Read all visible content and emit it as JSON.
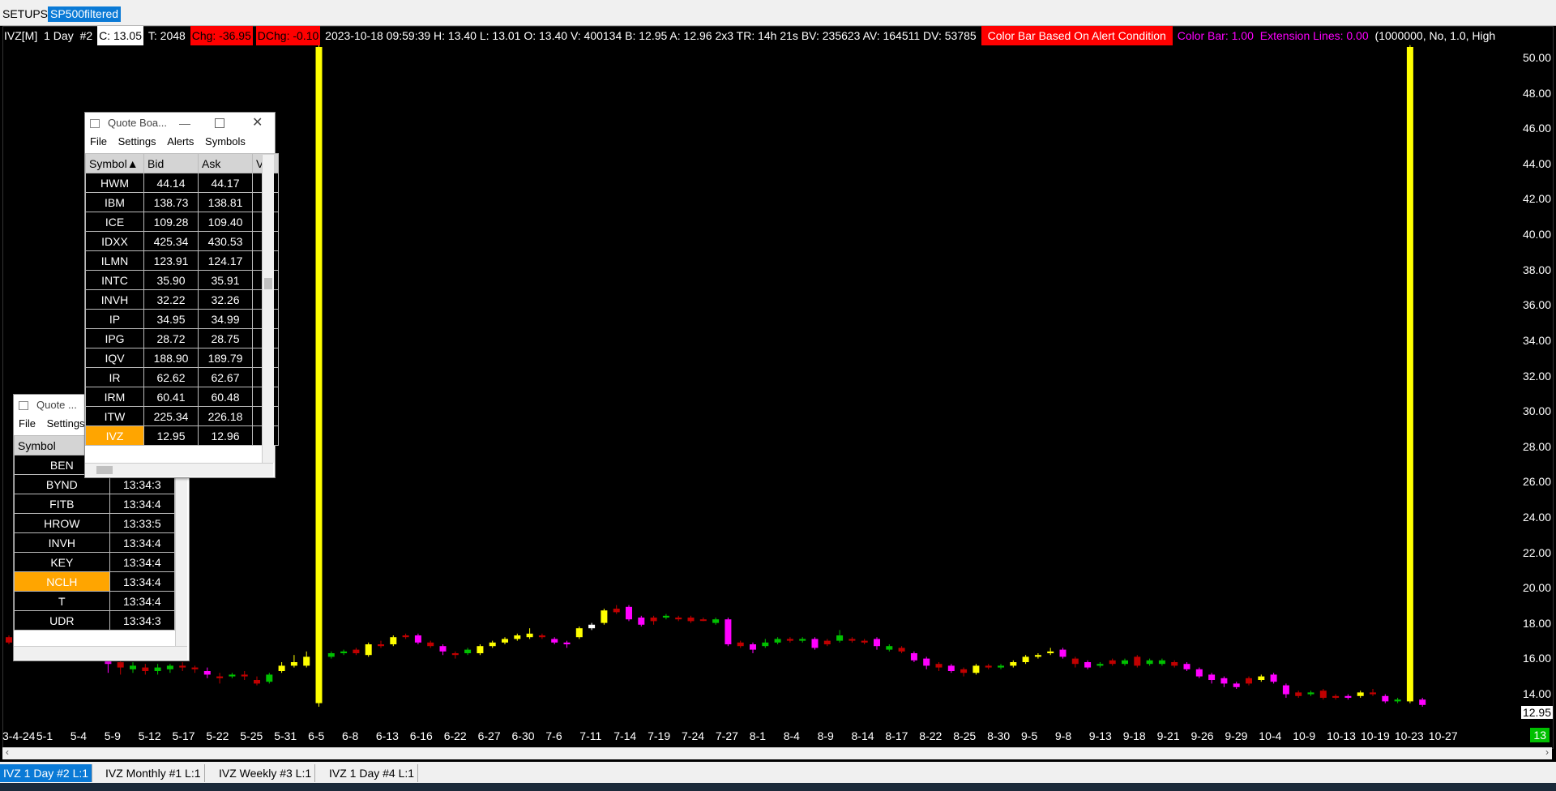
{
  "top_tabs": [
    "SETUPS",
    "SP500filtered"
  ],
  "infobar": {
    "symbol": "IVZ[M]",
    "interval": "1 Day",
    "chart_no": "#2",
    "close": "C: 13.05",
    "ticks": "T: 2048",
    "chg": "Chg: -36.95",
    "dchg": "DChg: -0.10",
    "details": "2023-10-18 09:59:39 H: 13.40 L: 13.01 O: 13.40 V: 400134 B: 12.95 A: 12.96 2x3 TR: 14h 21s BV: 235623 AV: 164511 DV: 53785",
    "alert": "Color Bar Based On Alert Condition",
    "color_bar": "Color Bar: 1.00",
    "extension": "Extension Lines: 0.00",
    "params": "(1000000, No, 1.0, High"
  },
  "price_box": "12.95",
  "y_ticks": [
    "50.00",
    "48.00",
    "46.00",
    "44.00",
    "42.00",
    "40.00",
    "38.00",
    "36.00",
    "34.00",
    "32.00",
    "30.00",
    "28.00",
    "26.00",
    "24.00",
    "22.00",
    "20.00",
    "18.00",
    "16.00",
    "14.00"
  ],
  "x_ticks": [
    "3-4-24",
    "5-1",
    "5-4",
    "5-9",
    "5-12",
    "5-17",
    "5-22",
    "5-25",
    "5-31",
    "6-5",
    "6-8",
    "6-13",
    "6-16",
    "6-22",
    "6-27",
    "6-30",
    "7-6",
    "7-11",
    "7-14",
    "7-19",
    "7-24",
    "7-27",
    "8-1",
    "8-4",
    "8-9",
    "8-14",
    "8-17",
    "8-22",
    "8-25",
    "8-30",
    "9-5",
    "9-8",
    "9-13",
    "9-18",
    "9-21",
    "9-26",
    "9-29",
    "10-4",
    "10-9",
    "10-13",
    "10-19",
    "10-23",
    "10-27"
  ],
  "x_last": "13",
  "quote_board": {
    "title": "Quote Boa...",
    "menu": [
      "File",
      "Settings",
      "Alerts",
      "Symbols"
    ],
    "headers": [
      "Symbol",
      "Bid",
      "Ask",
      "Vo"
    ],
    "rows": [
      {
        "symbol": "HWM",
        "bid": "44.14",
        "ask": "44.17"
      },
      {
        "symbol": "IBM",
        "bid": "138.73",
        "ask": "138.81"
      },
      {
        "symbol": "ICE",
        "bid": "109.28",
        "ask": "109.40"
      },
      {
        "symbol": "IDXX",
        "bid": "425.34",
        "ask": "430.53"
      },
      {
        "symbol": "ILMN",
        "bid": "123.91",
        "ask": "124.17"
      },
      {
        "symbol": "INTC",
        "bid": "35.90",
        "ask": "35.91"
      },
      {
        "symbol": "INVH",
        "bid": "32.22",
        "ask": "32.26"
      },
      {
        "symbol": "IP",
        "bid": "34.95",
        "ask": "34.99"
      },
      {
        "symbol": "IPG",
        "bid": "28.72",
        "ask": "28.75"
      },
      {
        "symbol": "IQV",
        "bid": "188.90",
        "ask": "189.79"
      },
      {
        "symbol": "IR",
        "bid": "62.62",
        "ask": "62.67"
      },
      {
        "symbol": "IRM",
        "bid": "60.41",
        "ask": "60.48"
      },
      {
        "symbol": "ITW",
        "bid": "225.34",
        "ask": "226.18"
      },
      {
        "symbol": "IVZ",
        "bid": "12.95",
        "ask": "12.96"
      }
    ]
  },
  "quote_small": {
    "title": "Quote ...",
    "menu": [
      "File",
      "Settings"
    ],
    "header": "Symbol",
    "rows": [
      {
        "symbol": "BEN",
        "time": ""
      },
      {
        "symbol": "BYND",
        "time": "13:34:3"
      },
      {
        "symbol": "FITB",
        "time": "13:34:4"
      },
      {
        "symbol": "HROW",
        "time": "13:33:5"
      },
      {
        "symbol": "INVH",
        "time": "13:34:4"
      },
      {
        "symbol": "KEY",
        "time": "13:34:4"
      },
      {
        "symbol": "NCLH",
        "time": "13:34:4"
      },
      {
        "symbol": "T",
        "time": "13:34:4"
      },
      {
        "symbol": "UDR",
        "time": "13:34:3"
      }
    ]
  },
  "bottom_tabs": [
    "IVZ  1 Day   #2 L:1",
    "IVZ  Monthly  #1 L:1",
    "IVZ  Weekly  #3 L:1",
    "IVZ  1 Day   #4 L:1"
  ],
  "chart_data": {
    "type": "candlestick",
    "ylim": [
      13.0,
      50.5
    ],
    "candles": [
      {
        "i": 0,
        "o": 16.9,
        "c": 16.6,
        "h": 17.0,
        "l": 16.5,
        "col": "#c00000"
      },
      {
        "i": 8,
        "o": 15.4,
        "c": 15.9,
        "h": 16.2,
        "l": 14.9,
        "col": "#ff00ff"
      },
      {
        "i": 9,
        "o": 15.5,
        "c": 15.2,
        "h": 15.8,
        "l": 14.8,
        "col": "#c00000"
      },
      {
        "i": 10,
        "o": 15.1,
        "c": 15.3,
        "h": 15.5,
        "l": 14.9,
        "col": "#00c000"
      },
      {
        "i": 11,
        "o": 15.2,
        "c": 15.0,
        "h": 15.4,
        "l": 14.8,
        "col": "#c00000"
      },
      {
        "i": 12,
        "o": 15.0,
        "c": 15.2,
        "h": 15.4,
        "l": 14.8,
        "col": "#00c000"
      },
      {
        "i": 13,
        "o": 15.1,
        "c": 15.3,
        "h": 15.4,
        "l": 14.9,
        "col": "#00c000"
      },
      {
        "i": 14,
        "o": 15.3,
        "c": 15.2,
        "h": 15.5,
        "l": 15.0,
        "col": "#c00000"
      },
      {
        "i": 15,
        "o": 15.2,
        "c": 15.1,
        "h": 15.3,
        "l": 14.9,
        "col": "#c00000"
      },
      {
        "i": 16,
        "o": 15.0,
        "c": 14.8,
        "h": 15.2,
        "l": 14.6,
        "col": "#ff00ff"
      },
      {
        "i": 17,
        "o": 14.7,
        "c": 14.6,
        "h": 14.9,
        "l": 14.3,
        "col": "#c00000"
      },
      {
        "i": 18,
        "o": 14.7,
        "c": 14.8,
        "h": 14.9,
        "l": 14.6,
        "col": "#00c000"
      },
      {
        "i": 19,
        "o": 14.8,
        "c": 14.7,
        "h": 15.0,
        "l": 14.5,
        "col": "#c00000"
      },
      {
        "i": 20,
        "o": 14.5,
        "c": 14.3,
        "h": 14.7,
        "l": 14.2,
        "col": "#c00000"
      },
      {
        "i": 21,
        "o": 14.4,
        "c": 14.8,
        "h": 14.9,
        "l": 14.3,
        "col": "#00c000"
      },
      {
        "i": 22,
        "o": 15.0,
        "c": 15.3,
        "h": 15.5,
        "l": 14.9,
        "col": "#ffff00"
      },
      {
        "i": 23,
        "o": 15.3,
        "c": 15.5,
        "h": 15.9,
        "l": 15.2,
        "col": "#ffff00"
      },
      {
        "i": 24,
        "o": 15.3,
        "c": 15.8,
        "h": 16.1,
        "l": 15.2,
        "col": "#ffff00"
      },
      {
        "i": 25,
        "o": 13.2,
        "c": 50.0,
        "h": 50.3,
        "l": 13.0,
        "col": "#ffff00"
      },
      {
        "i": 26,
        "o": 15.8,
        "c": 16.0,
        "h": 16.1,
        "l": 15.7,
        "col": "#00c000"
      },
      {
        "i": 27,
        "o": 16.0,
        "c": 16.1,
        "h": 16.2,
        "l": 15.9,
        "col": "#00c000"
      },
      {
        "i": 28,
        "o": 16.0,
        "c": 16.2,
        "h": 16.3,
        "l": 15.9,
        "col": "#c00000"
      },
      {
        "i": 29,
        "o": 15.9,
        "c": 16.5,
        "h": 16.6,
        "l": 15.8,
        "col": "#ffff00"
      },
      {
        "i": 30,
        "o": 16.5,
        "c": 16.4,
        "h": 16.7,
        "l": 16.3,
        "col": "#c00000"
      },
      {
        "i": 31,
        "o": 16.5,
        "c": 16.9,
        "h": 17.0,
        "l": 16.4,
        "col": "#ffff00"
      },
      {
        "i": 32,
        "o": 16.9,
        "c": 17.0,
        "h": 17.1,
        "l": 16.8,
        "col": "#c00000"
      },
      {
        "i": 33,
        "o": 17.0,
        "c": 16.6,
        "h": 17.1,
        "l": 16.5,
        "col": "#ff00ff"
      },
      {
        "i": 34,
        "o": 16.6,
        "c": 16.4,
        "h": 16.7,
        "l": 16.3,
        "col": "#c00000"
      },
      {
        "i": 35,
        "o": 16.4,
        "c": 16.1,
        "h": 16.5,
        "l": 15.9,
        "col": "#ff00ff"
      },
      {
        "i": 36,
        "o": 16.0,
        "c": 15.9,
        "h": 16.1,
        "l": 15.7,
        "col": "#c00000"
      },
      {
        "i": 37,
        "o": 16.0,
        "c": 16.2,
        "h": 16.3,
        "l": 15.9,
        "col": "#00c000"
      },
      {
        "i": 38,
        "o": 16.0,
        "c": 16.4,
        "h": 16.5,
        "l": 15.9,
        "col": "#ffff00"
      },
      {
        "i": 39,
        "o": 16.4,
        "c": 16.6,
        "h": 16.7,
        "l": 16.3,
        "col": "#ffff00"
      },
      {
        "i": 40,
        "o": 16.6,
        "c": 16.8,
        "h": 16.9,
        "l": 16.5,
        "col": "#ffff00"
      },
      {
        "i": 41,
        "o": 16.8,
        "c": 17.0,
        "h": 17.1,
        "l": 16.7,
        "col": "#ffff00"
      },
      {
        "i": 42,
        "o": 16.9,
        "c": 17.1,
        "h": 17.4,
        "l": 16.8,
        "col": "#ffff00"
      },
      {
        "i": 43,
        "o": 17.0,
        "c": 16.9,
        "h": 17.1,
        "l": 16.8,
        "col": "#c00000"
      },
      {
        "i": 44,
        "o": 16.8,
        "c": 16.6,
        "h": 16.9,
        "l": 16.5,
        "col": "#ff00ff"
      },
      {
        "i": 45,
        "o": 16.6,
        "c": 16.5,
        "h": 16.7,
        "l": 16.3,
        "col": "#ff00ff"
      },
      {
        "i": 46,
        "o": 16.9,
        "c": 17.4,
        "h": 17.5,
        "l": 16.8,
        "col": "#ffff00"
      },
      {
        "i": 47,
        "o": 17.4,
        "c": 17.6,
        "h": 17.7,
        "l": 17.3,
        "col": "#ffffff"
      },
      {
        "i": 48,
        "o": 17.7,
        "c": 18.4,
        "h": 18.5,
        "l": 17.6,
        "col": "#ffff00"
      },
      {
        "i": 49,
        "o": 18.5,
        "c": 18.3,
        "h": 18.7,
        "l": 18.2,
        "col": "#c00000"
      },
      {
        "i": 50,
        "o": 18.6,
        "c": 17.9,
        "h": 18.7,
        "l": 17.8,
        "col": "#ff00ff"
      },
      {
        "i": 51,
        "o": 18.0,
        "c": 17.6,
        "h": 18.1,
        "l": 17.5,
        "col": "#ff00ff"
      },
      {
        "i": 52,
        "o": 17.8,
        "c": 18.0,
        "h": 18.1,
        "l": 17.6,
        "col": "#c00000"
      },
      {
        "i": 53,
        "o": 18.0,
        "c": 18.1,
        "h": 18.2,
        "l": 17.9,
        "col": "#00c000"
      },
      {
        "i": 54,
        "o": 18.0,
        "c": 17.9,
        "h": 18.1,
        "l": 17.8,
        "col": "#c00000"
      },
      {
        "i": 55,
        "o": 18.0,
        "c": 17.8,
        "h": 18.1,
        "l": 17.7,
        "col": "#c00000"
      },
      {
        "i": 56,
        "o": 17.9,
        "c": 17.9,
        "h": 18.0,
        "l": 17.8,
        "col": "#c00000"
      },
      {
        "i": 57,
        "o": 17.7,
        "c": 17.9,
        "h": 18.0,
        "l": 17.6,
        "col": "#00c000"
      },
      {
        "i": 58,
        "o": 17.9,
        "c": 16.5,
        "h": 18.0,
        "l": 16.4,
        "col": "#ff00ff"
      },
      {
        "i": 59,
        "o": 16.6,
        "c": 16.4,
        "h": 16.7,
        "l": 16.3,
        "col": "#c00000"
      },
      {
        "i": 60,
        "o": 16.5,
        "c": 16.2,
        "h": 16.6,
        "l": 16.0,
        "col": "#ff00ff"
      },
      {
        "i": 61,
        "o": 16.4,
        "c": 16.6,
        "h": 16.8,
        "l": 16.3,
        "col": "#00c000"
      },
      {
        "i": 62,
        "o": 16.6,
        "c": 16.8,
        "h": 16.9,
        "l": 16.5,
        "col": "#00c000"
      },
      {
        "i": 63,
        "o": 16.8,
        "c": 16.7,
        "h": 16.9,
        "l": 16.6,
        "col": "#c00000"
      },
      {
        "i": 64,
        "o": 16.7,
        "c": 16.8,
        "h": 16.9,
        "l": 16.6,
        "col": "#00c000"
      },
      {
        "i": 65,
        "o": 16.8,
        "c": 16.3,
        "h": 16.9,
        "l": 16.2,
        "col": "#ff00ff"
      },
      {
        "i": 66,
        "o": 16.5,
        "c": 16.7,
        "h": 16.8,
        "l": 16.4,
        "col": "#c00000"
      },
      {
        "i": 67,
        "o": 16.7,
        "c": 17.0,
        "h": 17.3,
        "l": 16.6,
        "col": "#00c000"
      },
      {
        "i": 68,
        "o": 16.8,
        "c": 16.7,
        "h": 16.9,
        "l": 16.6,
        "col": "#c00000"
      },
      {
        "i": 69,
        "o": 16.7,
        "c": 16.6,
        "h": 16.8,
        "l": 16.5,
        "col": "#c00000"
      },
      {
        "i": 70,
        "o": 16.8,
        "c": 16.4,
        "h": 16.9,
        "l": 16.2,
        "col": "#ff00ff"
      },
      {
        "i": 71,
        "o": 16.4,
        "c": 16.2,
        "h": 16.5,
        "l": 16.1,
        "col": "#00c000"
      },
      {
        "i": 72,
        "o": 16.3,
        "c": 16.1,
        "h": 16.4,
        "l": 16.0,
        "col": "#c00000"
      },
      {
        "i": 73,
        "o": 16.0,
        "c": 15.6,
        "h": 16.1,
        "l": 15.5,
        "col": "#ff00ff"
      },
      {
        "i": 74,
        "o": 15.7,
        "c": 15.3,
        "h": 15.8,
        "l": 15.1,
        "col": "#ff00ff"
      },
      {
        "i": 75,
        "o": 15.4,
        "c": 15.2,
        "h": 15.5,
        "l": 15.0,
        "col": "#c00000"
      },
      {
        "i": 76,
        "o": 15.3,
        "c": 15.0,
        "h": 15.4,
        "l": 14.9,
        "col": "#ff00ff"
      },
      {
        "i": 77,
        "o": 15.1,
        "c": 14.9,
        "h": 15.2,
        "l": 14.7,
        "col": "#c00000"
      },
      {
        "i": 78,
        "o": 14.9,
        "c": 15.3,
        "h": 15.4,
        "l": 14.8,
        "col": "#ffff00"
      },
      {
        "i": 79,
        "o": 15.2,
        "c": 15.3,
        "h": 15.4,
        "l": 15.1,
        "col": "#c00000"
      },
      {
        "i": 80,
        "o": 15.3,
        "c": 15.2,
        "h": 15.4,
        "l": 15.1,
        "col": "#00c000"
      },
      {
        "i": 81,
        "o": 15.3,
        "c": 15.5,
        "h": 15.6,
        "l": 15.2,
        "col": "#ffff00"
      },
      {
        "i": 82,
        "o": 15.5,
        "c": 15.8,
        "h": 15.9,
        "l": 15.4,
        "col": "#ffff00"
      },
      {
        "i": 83,
        "o": 15.8,
        "c": 15.9,
        "h": 16.0,
        "l": 15.7,
        "col": "#ffff00"
      },
      {
        "i": 84,
        "o": 16.0,
        "c": 16.1,
        "h": 16.3,
        "l": 15.9,
        "col": "#ffff00"
      },
      {
        "i": 85,
        "o": 16.2,
        "c": 15.8,
        "h": 16.3,
        "l": 15.7,
        "col": "#ff00ff"
      },
      {
        "i": 86,
        "o": 15.7,
        "c": 15.4,
        "h": 15.8,
        "l": 15.2,
        "col": "#c00000"
      },
      {
        "i": 87,
        "o": 15.5,
        "c": 15.2,
        "h": 15.6,
        "l": 15.1,
        "col": "#ff00ff"
      },
      {
        "i": 88,
        "o": 15.3,
        "c": 15.4,
        "h": 15.5,
        "l": 15.2,
        "col": "#00c000"
      },
      {
        "i": 89,
        "o": 15.4,
        "c": 15.6,
        "h": 15.7,
        "l": 15.3,
        "col": "#c00000"
      },
      {
        "i": 90,
        "o": 15.4,
        "c": 15.6,
        "h": 15.7,
        "l": 15.3,
        "col": "#00c000"
      },
      {
        "i": 91,
        "o": 15.8,
        "c": 15.3,
        "h": 15.9,
        "l": 15.2,
        "col": "#c00000"
      },
      {
        "i": 92,
        "o": 15.4,
        "c": 15.6,
        "h": 15.7,
        "l": 15.3,
        "col": "#00c000"
      },
      {
        "i": 93,
        "o": 15.6,
        "c": 15.4,
        "h": 15.7,
        "l": 15.3,
        "col": "#00c000"
      },
      {
        "i": 94,
        "o": 15.5,
        "c": 15.3,
        "h": 15.6,
        "l": 15.2,
        "col": "#c00000"
      },
      {
        "i": 95,
        "o": 15.4,
        "c": 15.1,
        "h": 15.5,
        "l": 15.0,
        "col": "#ff00ff"
      },
      {
        "i": 96,
        "o": 15.1,
        "c": 14.7,
        "h": 15.2,
        "l": 14.6,
        "col": "#ff00ff"
      },
      {
        "i": 97,
        "o": 14.8,
        "c": 14.5,
        "h": 14.9,
        "l": 14.3,
        "col": "#ff00ff"
      },
      {
        "i": 98,
        "o": 14.6,
        "c": 14.3,
        "h": 14.7,
        "l": 14.1,
        "col": "#ff00ff"
      },
      {
        "i": 99,
        "o": 14.3,
        "c": 14.1,
        "h": 14.4,
        "l": 14.0,
        "col": "#ff00ff"
      },
      {
        "i": 100,
        "o": 14.3,
        "c": 14.6,
        "h": 14.7,
        "l": 14.2,
        "col": "#c00000"
      },
      {
        "i": 101,
        "o": 14.5,
        "c": 14.7,
        "h": 14.8,
        "l": 14.4,
        "col": "#ffff00"
      },
      {
        "i": 102,
        "o": 14.8,
        "c": 14.4,
        "h": 14.9,
        "l": 14.3,
        "col": "#ff00ff"
      },
      {
        "i": 103,
        "o": 14.2,
        "c": 13.7,
        "h": 14.3,
        "l": 13.5,
        "col": "#ff00ff"
      },
      {
        "i": 104,
        "o": 13.8,
        "c": 13.6,
        "h": 13.9,
        "l": 13.5,
        "col": "#c00000"
      },
      {
        "i": 105,
        "o": 13.7,
        "c": 13.8,
        "h": 13.9,
        "l": 13.6,
        "col": "#00c000"
      },
      {
        "i": 106,
        "o": 13.9,
        "c": 13.5,
        "h": 14.0,
        "l": 13.4,
        "col": "#c00000"
      },
      {
        "i": 107,
        "o": 13.5,
        "c": 13.6,
        "h": 13.7,
        "l": 13.4,
        "col": "#c00000"
      },
      {
        "i": 108,
        "o": 13.6,
        "c": 13.5,
        "h": 13.7,
        "l": 13.4,
        "col": "#ff00ff"
      },
      {
        "i": 109,
        "o": 13.6,
        "c": 13.8,
        "h": 13.9,
        "l": 13.5,
        "col": "#ffff00"
      },
      {
        "i": 110,
        "o": 13.8,
        "c": 13.7,
        "h": 14.0,
        "l": 13.6,
        "col": "#c00000"
      },
      {
        "i": 111,
        "o": 13.6,
        "c": 13.3,
        "h": 13.7,
        "l": 13.2,
        "col": "#ff00ff"
      },
      {
        "i": 112,
        "o": 13.3,
        "c": 13.4,
        "h": 13.5,
        "l": 13.2,
        "col": "#00c000"
      },
      {
        "i": 113,
        "o": 13.3,
        "c": 50.0,
        "h": 50.1,
        "l": 13.2,
        "col": "#ffff00"
      },
      {
        "i": 114,
        "o": 13.4,
        "c": 13.1,
        "h": 13.5,
        "l": 13.0,
        "col": "#ff00ff"
      }
    ],
    "n_slots": 121
  }
}
